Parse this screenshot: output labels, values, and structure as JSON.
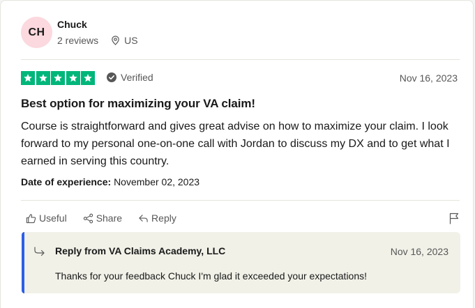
{
  "reviewer": {
    "initials": "CH",
    "name": "Chuck",
    "reviews_count": "2 reviews",
    "location": "US",
    "avatar_color": "#fbd9de"
  },
  "review": {
    "rating": 5,
    "star_color": "#00b67a",
    "verified_label": "Verified",
    "date": "Nov 16, 2023",
    "title": "Best option for maximizing your VA claim!",
    "body": "Course is straightforward and gives great advise on how to maximize your claim. I look forward to my personal one-on-one call with Jordan to discuss my DX and to get what I earned in serving this country.",
    "experience_label": "Date of experience:",
    "experience_date": "November 02, 2023"
  },
  "actions": {
    "useful_label": "Useful",
    "share_label": "Share",
    "reply_label": "Reply",
    "flag_icon": "flag-icon"
  },
  "reply": {
    "from": "Reply from VA Claims Academy, LLC",
    "date": "Nov 16, 2023",
    "text": "Thanks for your feedback Chuck I'm glad it exceeded your expectations!",
    "accent_color": "#2e5ee6"
  }
}
